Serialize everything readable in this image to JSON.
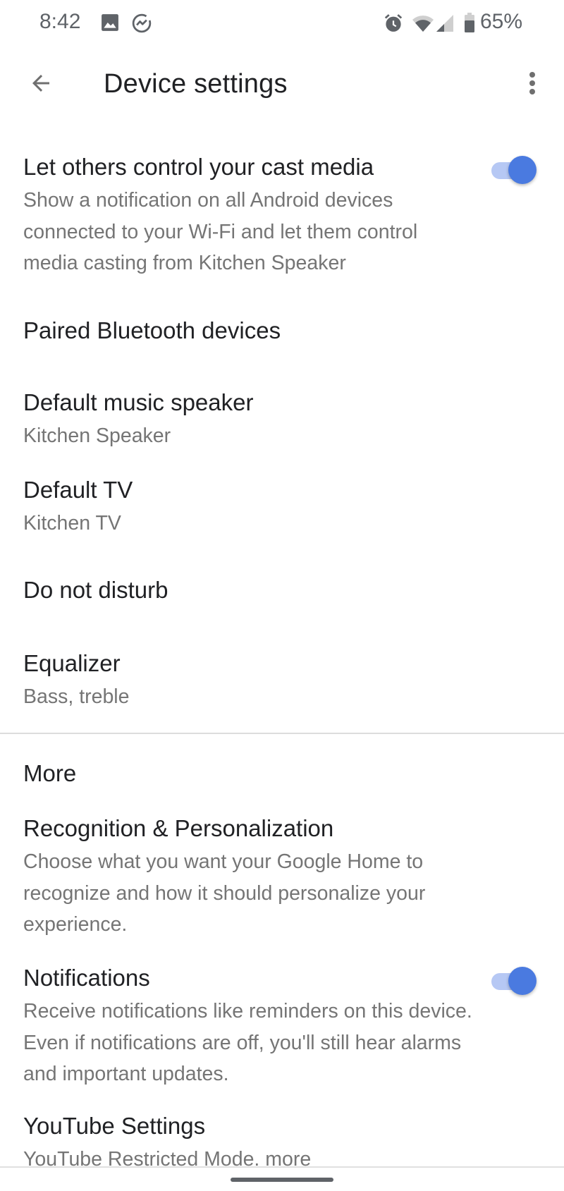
{
  "status_bar": {
    "time": "8:42",
    "left_icons": [
      "gallery-icon",
      "messenger-icon"
    ],
    "right_icons": [
      "alarm-icon",
      "wifi-icon",
      "cellular-signal-icon",
      "battery-icon"
    ],
    "battery_percent": "65%"
  },
  "app_bar": {
    "back_icon": "arrow-back-icon",
    "title": "Device settings",
    "overflow_icon": "more-vert-icon"
  },
  "settings": [
    {
      "title": "Let others control your cast media",
      "subtitle": "Show a notification on all Android devices connected to your Wi-Fi and let them control media casting from Kitchen Speaker",
      "toggle": true
    },
    {
      "title": "Paired Bluetooth devices"
    },
    {
      "title": "Default music speaker",
      "subtitle": "Kitchen Speaker"
    },
    {
      "title": "Default TV",
      "subtitle": "Kitchen TV"
    },
    {
      "title": "Do not disturb"
    },
    {
      "title": "Equalizer",
      "subtitle": "Bass, treble"
    }
  ],
  "more_section": {
    "header": "More",
    "items": [
      {
        "title": "Recognition & Personalization",
        "subtitle": "Choose what you want your Google Home to recognize and how it should personalize your experience."
      },
      {
        "title": "Notifications",
        "subtitle": "Receive notifications like reminders on this device. Even if notifications are off, you'll still hear alarms and important updates.",
        "toggle": true
      },
      {
        "title": "YouTube Settings",
        "subtitle": "YouTube Restricted Mode. more"
      }
    ]
  },
  "colors": {
    "accent": "#4a7ae0",
    "toggle_track": "#b6c8f4",
    "primary_text": "#202124",
    "secondary_text": "#757575",
    "icon_gray": "#5f6368",
    "divider": "#dcdcdc"
  }
}
